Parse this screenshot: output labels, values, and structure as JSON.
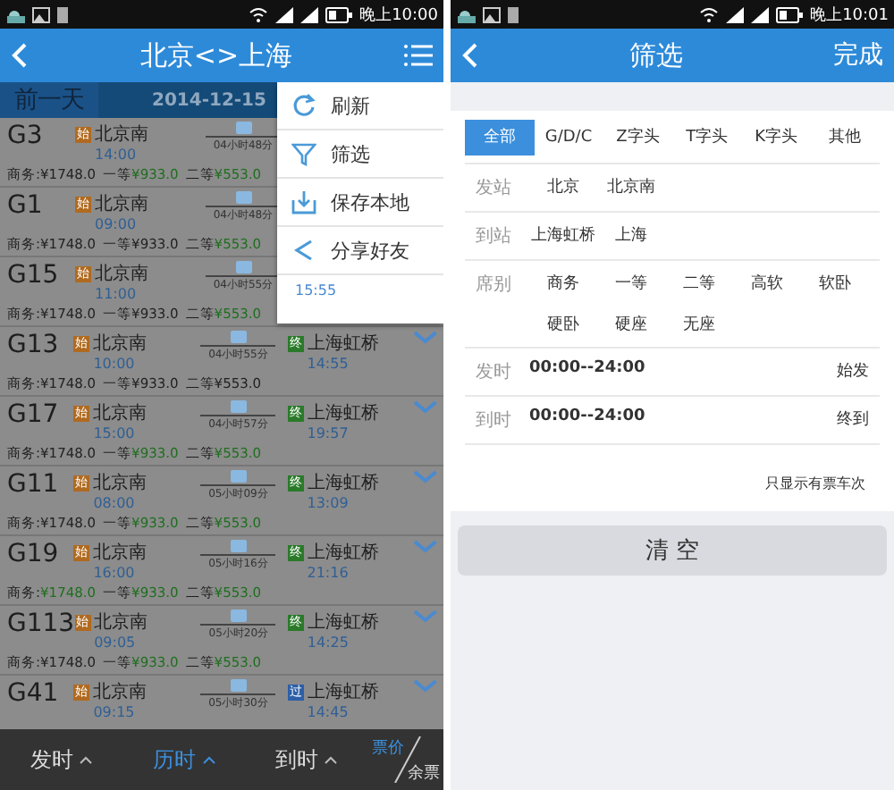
{
  "left_screen": {
    "status_bar": {
      "time": "晚上10:00"
    },
    "header": {
      "title": "北京<>上海"
    },
    "date_bar": {
      "prev": "前一天",
      "date": "2014-12-15"
    },
    "dimmed": true,
    "trains": [
      {
        "number": "G3",
        "from": {
          "badge": {
            "label": "始",
            "color": "#b06a20"
          },
          "name": "北京南",
          "time": "14:00"
        },
        "duration": "04小时48分",
        "seats": [
          {
            "label": "商务:",
            "price": "¥1748.0",
            "color": "#222222"
          },
          {
            "label": "一等",
            "price": "¥933.0",
            "color": "#1f6e1f"
          },
          {
            "label": "二等",
            "price": "¥553.0",
            "color": "#1f6e1f"
          }
        ]
      },
      {
        "number": "G1",
        "from": {
          "badge": {
            "label": "始",
            "color": "#b06a20"
          },
          "name": "北京南",
          "time": "09:00"
        },
        "duration": "04小时48分",
        "seats": [
          {
            "label": "商务:",
            "price": "¥1748.0",
            "color": "#222222"
          },
          {
            "label": "一等",
            "price": "¥933.0",
            "color": "#222222"
          },
          {
            "label": "二等",
            "price": "¥553.0",
            "color": "#1f6e1f"
          }
        ]
      },
      {
        "number": "G15",
        "from": {
          "badge": {
            "label": "始",
            "color": "#b06a20"
          },
          "name": "北京南",
          "time": "11:00"
        },
        "duration": "04小时55分",
        "seats": [
          {
            "label": "商务:",
            "price": "¥1748.0",
            "color": "#222222"
          },
          {
            "label": "一等",
            "price": "¥933.0",
            "color": "#222222"
          },
          {
            "label": "二等",
            "price": "¥553.0",
            "color": "#1f6e1f"
          }
        ]
      },
      {
        "number": "G13",
        "from": {
          "badge": {
            "label": "始",
            "color": "#b06a20"
          },
          "name": "北京南",
          "time": "10:00"
        },
        "duration": "04小时55分",
        "to": {
          "badge": {
            "label": "终",
            "color": "#2a7a2a"
          },
          "name": "上海虹桥",
          "time": "14:55"
        },
        "seats": [
          {
            "label": "商务:",
            "price": "¥1748.0",
            "color": "#222222"
          },
          {
            "label": "一等",
            "price": "¥933.0",
            "color": "#222222"
          },
          {
            "label": "二等",
            "price": "¥553.0",
            "color": "#222222"
          }
        ]
      },
      {
        "number": "G17",
        "from": {
          "badge": {
            "label": "始",
            "color": "#b06a20"
          },
          "name": "北京南",
          "time": "15:00"
        },
        "duration": "04小时57分",
        "to": {
          "badge": {
            "label": "终",
            "color": "#2a7a2a"
          },
          "name": "上海虹桥",
          "time": "19:57"
        },
        "seats": [
          {
            "label": "商务:",
            "price": "¥1748.0",
            "color": "#222222"
          },
          {
            "label": "一等",
            "price": "¥933.0",
            "color": "#1f6e1f"
          },
          {
            "label": "二等",
            "price": "¥553.0",
            "color": "#1f6e1f"
          }
        ]
      },
      {
        "number": "G11",
        "from": {
          "badge": {
            "label": "始",
            "color": "#b06a20"
          },
          "name": "北京南",
          "time": "08:00"
        },
        "duration": "05小时09分",
        "to": {
          "badge": {
            "label": "终",
            "color": "#2a7a2a"
          },
          "name": "上海虹桥",
          "time": "13:09"
        },
        "seats": [
          {
            "label": "商务:",
            "price": "¥1748.0",
            "color": "#222222"
          },
          {
            "label": "一等",
            "price": "¥933.0",
            "color": "#1f6e1f"
          },
          {
            "label": "二等",
            "price": "¥553.0",
            "color": "#1f6e1f"
          }
        ]
      },
      {
        "number": "G19",
        "from": {
          "badge": {
            "label": "始",
            "color": "#b06a20"
          },
          "name": "北京南",
          "time": "16:00"
        },
        "duration": "05小时16分",
        "to": {
          "badge": {
            "label": "终",
            "color": "#2a7a2a"
          },
          "name": "上海虹桥",
          "time": "21:16"
        },
        "seats": [
          {
            "label": "商务:",
            "price": "¥1748.0",
            "color": "#1f6e1f"
          },
          {
            "label": "一等",
            "price": "¥933.0",
            "color": "#1f6e1f"
          },
          {
            "label": "二等",
            "price": "¥553.0",
            "color": "#1f6e1f"
          }
        ]
      },
      {
        "number": "G113",
        "from": {
          "badge": {
            "label": "始",
            "color": "#b06a20"
          },
          "name": "北京南",
          "time": "09:05"
        },
        "duration": "05小时20分",
        "to": {
          "badge": {
            "label": "终",
            "color": "#2a7a2a"
          },
          "name": "上海虹桥",
          "time": "14:25"
        },
        "seats": [
          {
            "label": "商务:",
            "price": "¥1748.0",
            "color": "#222222"
          },
          {
            "label": "一等",
            "price": "¥933.0",
            "color": "#1f6e1f"
          },
          {
            "label": "二等",
            "price": "¥553.0",
            "color": "#1f6e1f"
          }
        ]
      },
      {
        "number": "G41",
        "from": {
          "badge": {
            "label": "始",
            "color": "#b06a20"
          },
          "name": "北京南",
          "time": "09:15"
        },
        "duration": "05小时30分",
        "to": {
          "badge": {
            "label": "过",
            "color": "#2d5fa8"
          },
          "name": "上海虹桥",
          "time": "14:45"
        }
      }
    ],
    "menu": {
      "items": [
        {
          "kind": "refresh",
          "label": "刷新"
        },
        {
          "kind": "filter",
          "label": "筛选"
        },
        {
          "kind": "save",
          "label": "保存本地"
        },
        {
          "kind": "share",
          "label": "分享好友"
        }
      ],
      "visible_time": "15:55"
    },
    "sort_bar": {
      "items": [
        {
          "label": "发时",
          "selected": false
        },
        {
          "label": "历时",
          "selected": true
        },
        {
          "label": "到时",
          "selected": false
        }
      ],
      "price": {
        "label": "票价",
        "selected": true
      },
      "tickets": {
        "label": "余票",
        "selected": false
      }
    }
  },
  "right_screen": {
    "status_bar": {
      "time": "晚上10:01"
    },
    "header": {
      "title": "筛选",
      "action": "完成"
    },
    "tabs": [
      {
        "label": "全部",
        "selected": true
      },
      {
        "label": "G/D/C",
        "selected": false
      },
      {
        "label": "Z字头",
        "selected": false
      },
      {
        "label": "T字头",
        "selected": false
      },
      {
        "label": "K字头",
        "selected": false
      },
      {
        "label": "其他",
        "selected": false
      }
    ],
    "rows": [
      {
        "kind": "options",
        "label": "发站",
        "options": [
          "北京",
          "北京南"
        ]
      },
      {
        "kind": "options",
        "label": "到站",
        "options": [
          "上海虹桥",
          "上海"
        ]
      },
      {
        "kind": "options",
        "label": "席别",
        "options": [
          "商务",
          "一等",
          "二等",
          "高软",
          "软卧",
          "硬卧",
          "硬座",
          "无座"
        ]
      },
      {
        "kind": "time",
        "label": "发时",
        "range": "00:00--24:00",
        "action": "始发"
      },
      {
        "kind": "time",
        "label": "到时",
        "range": "00:00--24:00",
        "action": "终到"
      }
    ],
    "only_available": "只显示有票车次",
    "clear_button": "清 空"
  }
}
